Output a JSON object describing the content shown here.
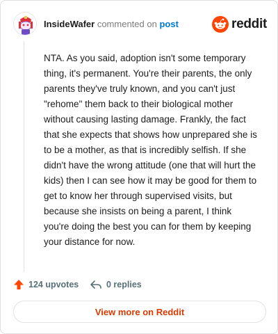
{
  "comment": {
    "username": "InsideWafer",
    "action_text": "commented on",
    "post_link_text": "post",
    "body": "NTA. As you said, adoption isn't some temporary thing, it's permanent. You're their parents, the only parents they've truly known, and you can't just \"rehome\" them back to their biological mother without causing lasting damage. Frankly, the fact that she expects that shows how unprepared she is to be a mother, as that is incredibly selfish. If she didn't have the wrong attitude (one that will hurt the kids) then I can see how it may be good for them to get to know her through supervised visits, but because she insists on being a parent, I think you're doing the best you can for them by keeping your distance for now."
  },
  "brand": {
    "wordmark": "reddit",
    "color": "#ff4500"
  },
  "footer": {
    "upvotes": "124 upvotes",
    "replies": "0 replies",
    "upvote_icon": "upvote-arrow-icon",
    "reply_icon": "reply-arrow-icon"
  },
  "view_more_label": "View more on Reddit",
  "colors": {
    "accent": "#d93a00",
    "link": "#0079d3",
    "upvote": "#ff4500"
  }
}
